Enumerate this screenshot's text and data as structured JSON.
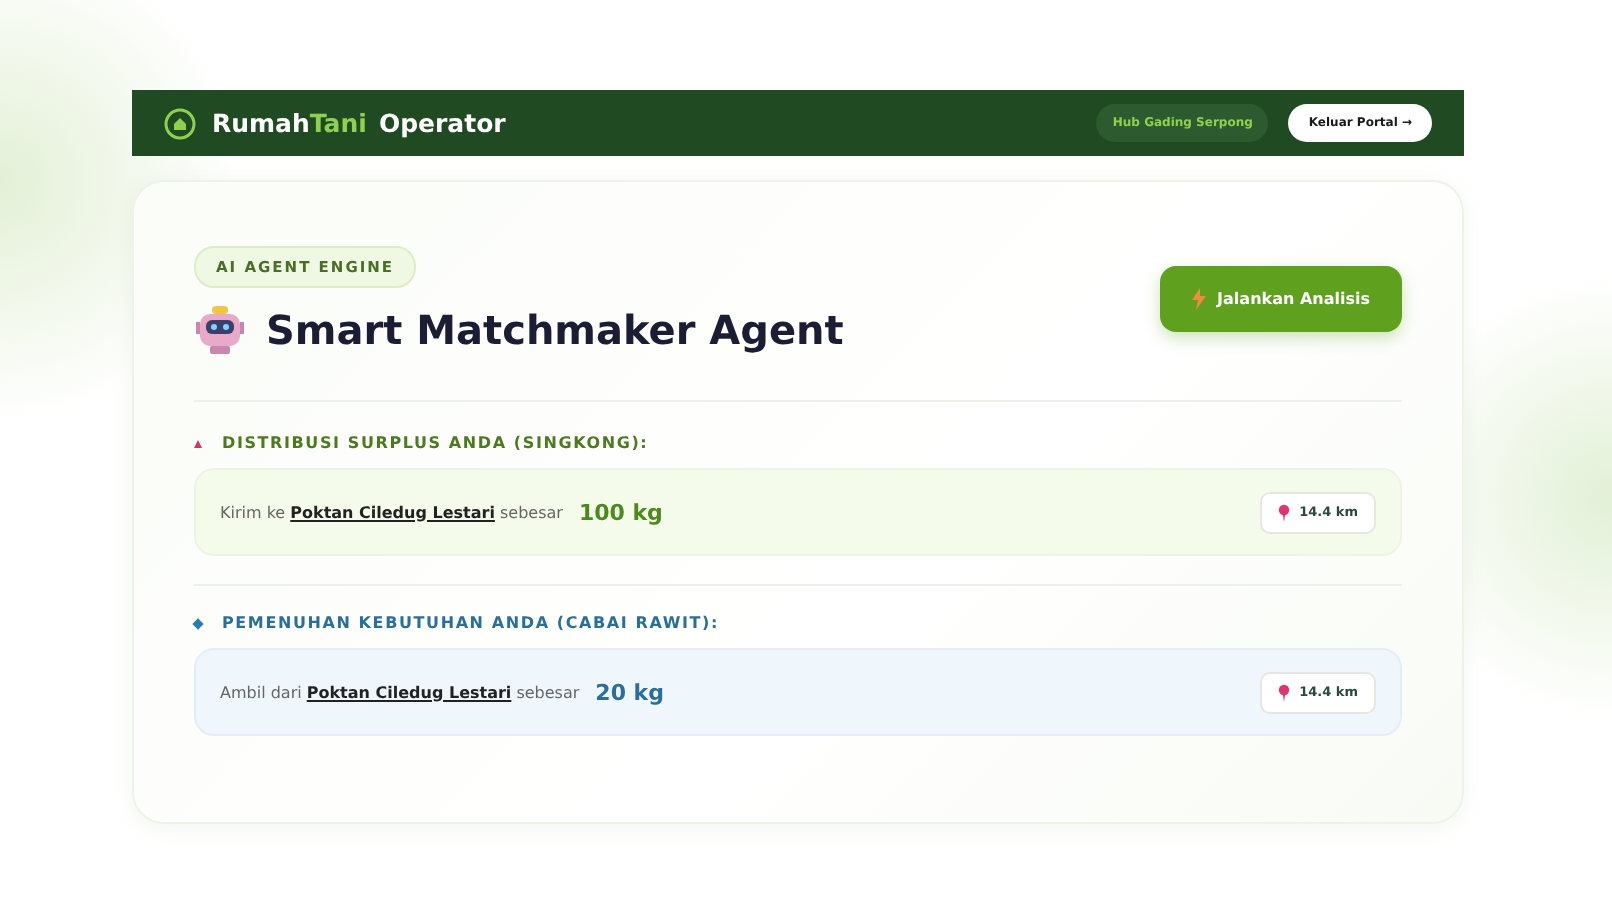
{
  "header": {
    "brand_main": "Rumah",
    "brand_accent": "Tani",
    "brand_suffix": "Operator",
    "hub": "Hub Gading Serpong",
    "logout": "Keluar Portal →"
  },
  "agent": {
    "badge": "AI AGENT ENGINE",
    "title": "Smart Matchmaker Agent",
    "run_button": "Jalankan Analisis"
  },
  "sections": [
    {
      "kind": "surplus",
      "heading": "DISTRIBUSI SURPLUS ANDA (SINGKONG):",
      "prefix": "Kirim ke",
      "partner": "Poktan Ciledug Lestari",
      "suffix": "sebesar",
      "amount": "100 kg",
      "distance": "14.4 km"
    },
    {
      "kind": "need",
      "heading": "PEMENUHAN KEBUTUHAN ANDA (CABAI RAWIT):",
      "prefix": "Ambil dari",
      "partner": "Poktan Ciledug Lestari",
      "suffix": "sebesar",
      "amount": "20 kg",
      "distance": "14.4 km"
    }
  ]
}
